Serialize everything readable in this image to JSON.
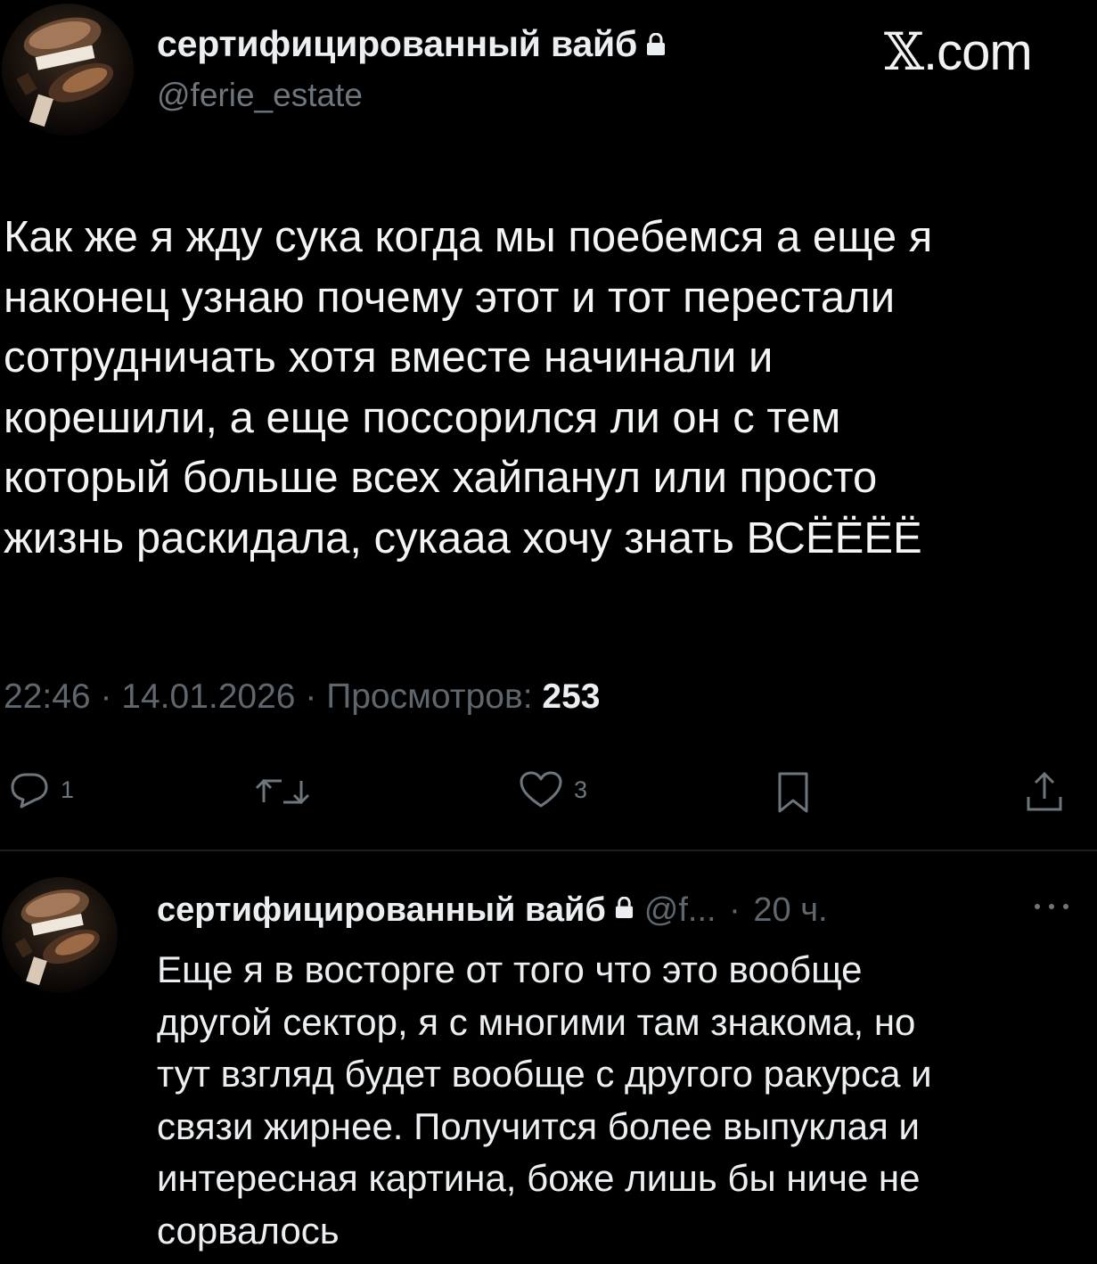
{
  "main_tweet": {
    "author_name": "сертифицированный вайб",
    "handle": "@ferie_estate",
    "body_lines": [
      "Как же я жду сука когда мы поебемся а еще я",
      "наконец узнаю почему этот и тот перестали",
      "сотрудничать хотя вместе начинали и",
      "корешили, а еще поссорился ли он с тем",
      "который больше всех хайпанул или просто",
      "жизнь раскидала, сукааа хочу знать ВСЁЁЁЁ"
    ],
    "time": "22:46",
    "date": "14.01.2026",
    "separator": "·",
    "views_label": "Просмотров:",
    "views_count": "253",
    "actions": {
      "reply_count": "1",
      "like_count": "3"
    }
  },
  "watermark": {
    "x_glyph": "𝕏",
    "suffix": ".com"
  },
  "reply_tweet": {
    "author_name": "сертифицированный вайб",
    "handle_truncated": "@f...",
    "separator": "·",
    "time_ago": "20 ч.",
    "body_lines": [
      "Еще я в восторге от того что это вообще",
      "другой сектор, я с многими там знакома, но",
      "тут взгляд будет вообще с другого ракурса и",
      "связи жирнее. Получится более выпуклая и",
      "интересная картина, боже лишь бы ниче не",
      "сорвалось"
    ]
  },
  "icons": {
    "lock": "lock-icon",
    "reply": "reply-bubble-icon",
    "retweet": "retweet-icon",
    "like": "heart-icon",
    "bookmark": "bookmark-icon",
    "share": "share-icon",
    "more": "more-dots-icon"
  },
  "colors": {
    "background": "#000000",
    "text_primary": "#eceff1",
    "text_muted": "#6e767d",
    "divider": "#1c1f22"
  }
}
